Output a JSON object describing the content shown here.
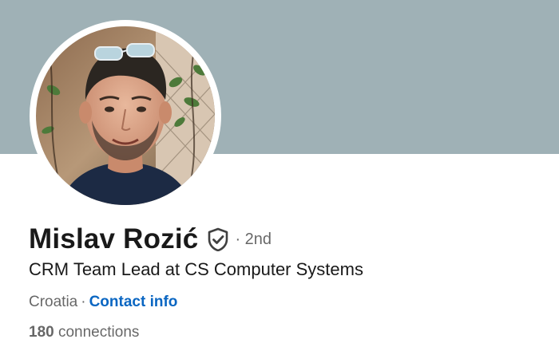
{
  "profile": {
    "name": "Mislav Rozić",
    "degree": "· 2nd",
    "headline": "CRM Team Lead at CS Computer Systems",
    "location": "Croatia",
    "separator": "·",
    "contact_label": "Contact info",
    "connections_count": "180",
    "connections_label": " connections",
    "verified_icon": "shield-check-icon"
  },
  "colors": {
    "banner": "#9fb1b6",
    "link": "#0a66c2"
  }
}
